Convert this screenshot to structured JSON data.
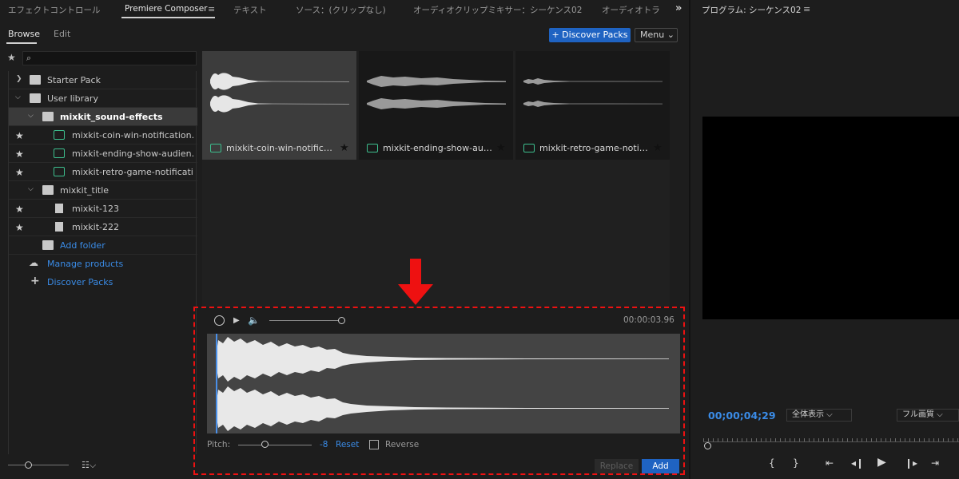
{
  "tabs": [
    "エフェクトコントロール",
    "Premiere Composer",
    "テキスト",
    "ソース：(クリップなし)",
    "オーディオクリップミキサー：シーケンス02",
    "オーディオトラ"
  ],
  "subtabs": {
    "browse": "Browse",
    "edit": "Edit"
  },
  "toolbar": {
    "discover_packs": "+ Discover Packs",
    "menu": "Menu ⌄"
  },
  "tree": {
    "starter_pack": "Starter Pack",
    "user_library": "User library",
    "folder_sound": "mixkit_sound-effects",
    "items_sound": [
      "mixkit-coin-win-notification...",
      "mixkit-ending-show-audien...",
      "mixkit-retro-game-notificati..."
    ],
    "folder_title": "mixkit_title",
    "items_title": [
      "mixkit-123",
      "mixkit-222"
    ],
    "add_folder": "Add folder",
    "manage_products": "Manage products",
    "discover_packs": "Discover Packs"
  },
  "grid": {
    "cards": [
      {
        "name": "mixkit-coin-win-notificat..."
      },
      {
        "name": "mixkit-ending-show-audi..."
      },
      {
        "name": "mixkit-retro-game-notifi..."
      }
    ]
  },
  "preview": {
    "timecode": "00:00:03.96",
    "pitch_label": "Pitch:",
    "pitch_value": "-8",
    "reset": "Reset",
    "reverse": "Reverse",
    "replace": "Replace",
    "add": "Add",
    "volume_level": 1.0,
    "pitch_slider_level": 0.36
  },
  "program": {
    "title": "プログラム: シーケンス02",
    "timecode": "00;00;04;29",
    "fit": "全体表示 ⌵",
    "quality": "フル画質 ⌵"
  },
  "colors": {
    "accent": "#1f63c2",
    "link": "#3a8be6",
    "annotation": "#ee1111",
    "audio_icon": "#3dbf8e"
  },
  "icons": [
    "star-icon",
    "search-icon",
    "folder-icon",
    "library-icon",
    "audio-clip-icon",
    "document-icon",
    "add-folder-icon",
    "cloud-icon",
    "plus-icon",
    "replay-icon",
    "play-icon",
    "volume-icon",
    "hamburger-icon",
    "overflow-icon"
  ]
}
